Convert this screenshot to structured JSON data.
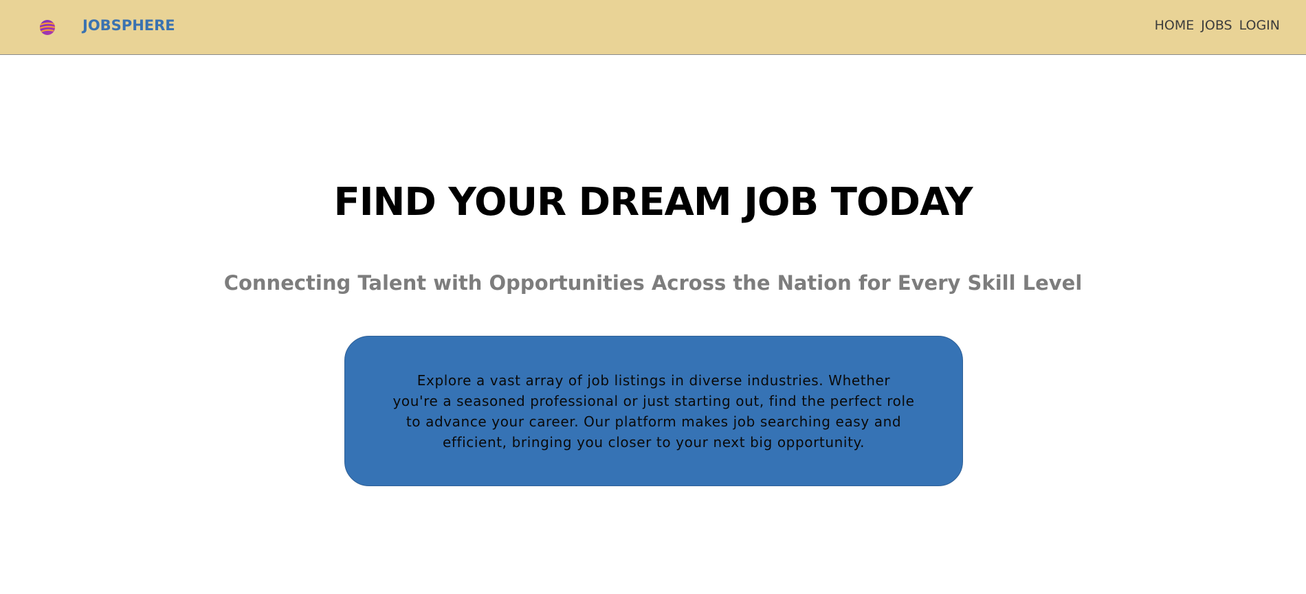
{
  "header": {
    "brand": "JOBSPHERE",
    "logo_icon": "globe-logo-icon",
    "background_color": "#e9d396",
    "brand_color": "#3a72b0",
    "nav": [
      {
        "label": "HOME"
      },
      {
        "label": "JOBS"
      },
      {
        "label": "LOGIN"
      }
    ]
  },
  "hero": {
    "title": "FIND YOUR DREAM JOB TODAY",
    "subtitle": "Connecting Talent with Opportunities Across the Nation for Every Skill Level",
    "description": "Explore a vast array of job listings in diverse industries. Whether you're a seasoned professional or just starting out, find the perfect role to advance your career. Our platform makes job searching easy and efficient, bringing you closer to your next big opportunity.",
    "box_color": "#3673b5"
  }
}
